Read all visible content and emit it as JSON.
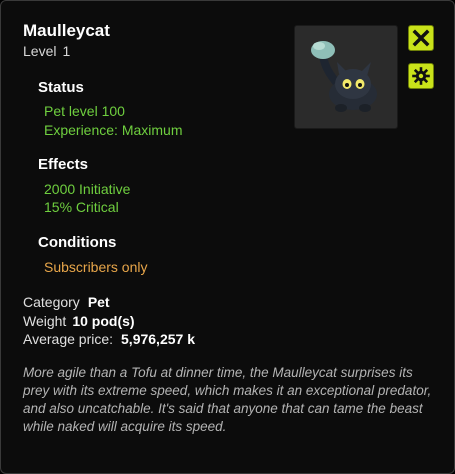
{
  "item": {
    "name": "Maulleycat",
    "level_label": "Level",
    "level_value": "1"
  },
  "status": {
    "heading": "Status",
    "lines": [
      "Pet level 100",
      "Experience: Maximum"
    ]
  },
  "effects": {
    "heading": "Effects",
    "lines": [
      "2000 Initiative",
      "15% Critical"
    ]
  },
  "conditions": {
    "heading": "Conditions",
    "lines": [
      "Subscribers only"
    ]
  },
  "details": {
    "category_label": "Category",
    "category_value": "Pet",
    "weight_label": "Weight",
    "weight_value": "10 pod(s)",
    "price_label": "Average price:",
    "price_value": "5,976,257 k"
  },
  "description": "More agile than a Tofu at dinner time, the Maulleycat surprises its prey with its extreme speed, which makes it an exceptional predator, and also uncatchable. It's said that anyone that can tame the beast while naked will acquire its speed.",
  "buttons": {
    "close_icon": "close-icon",
    "gear_icon": "gear-icon"
  },
  "colors": {
    "accent": "#c9e21a",
    "effect_green": "#6fcf3f",
    "condition_orange": "#e8a64a"
  }
}
